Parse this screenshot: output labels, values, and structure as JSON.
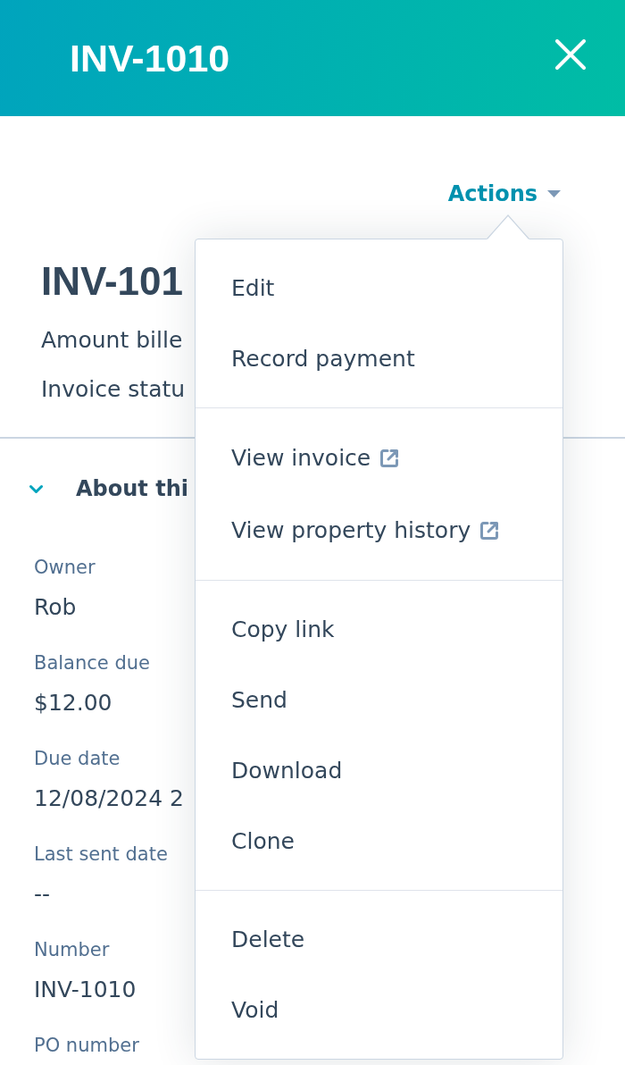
{
  "panel_header": {
    "title": "INV-1010"
  },
  "record": {
    "actions_label": "Actions",
    "title": "INV-101",
    "summary": [
      "Amount bille",
      "Invoice statu"
    ]
  },
  "about_section": {
    "title": "About thi",
    "expanded": true,
    "properties": [
      {
        "label": "Owner",
        "value": "Rob"
      },
      {
        "label": "Balance due",
        "value": "$12.00"
      },
      {
        "label": "Due date",
        "value": "12/08/2024 2"
      },
      {
        "label": "Last sent date",
        "value": "--"
      },
      {
        "label": "Number",
        "value": "INV-1010"
      },
      {
        "label": "PO number"
      }
    ]
  },
  "actions_menu": {
    "open": true,
    "groups": [
      {
        "items": [
          {
            "label": "Edit",
            "external": false
          },
          {
            "label": "Record payment",
            "external": false
          }
        ]
      },
      {
        "items": [
          {
            "label": "View invoice",
            "external": true
          },
          {
            "label": "View property history",
            "external": true
          }
        ]
      },
      {
        "items": [
          {
            "label": "Copy link",
            "external": false
          },
          {
            "label": "Send",
            "external": false
          },
          {
            "label": "Download",
            "external": false
          },
          {
            "label": "Clone",
            "external": false
          }
        ]
      },
      {
        "items": [
          {
            "label": "Delete",
            "external": false
          },
          {
            "label": "Void",
            "external": false
          }
        ]
      }
    ]
  }
}
